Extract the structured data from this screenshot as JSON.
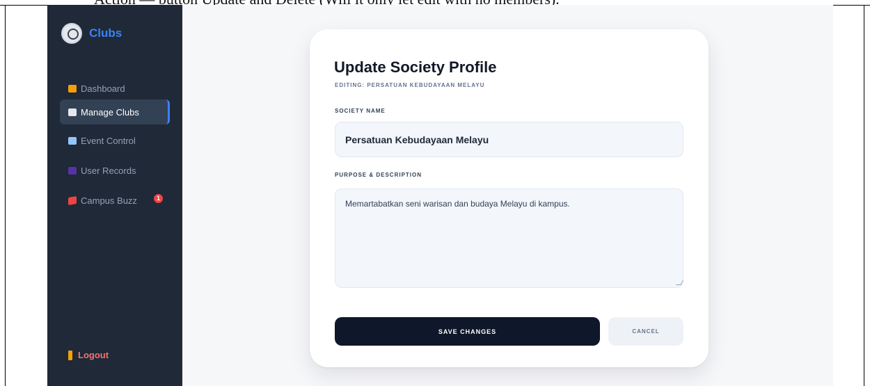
{
  "document": {
    "caption": "Action — button Update and Delete (Will it only let edit with no members)."
  },
  "app": {
    "name": "Clubs",
    "colors": {
      "brand": "#3b82f6",
      "sidebar": "#1f2937",
      "primary_button": "#0f172a",
      "badge": "#ef4444"
    }
  },
  "sidebar": {
    "items": [
      {
        "label": "Dashboard",
        "icon": "house-icon",
        "active": false
      },
      {
        "label": "Manage Clubs",
        "icon": "bank-icon",
        "active": true
      },
      {
        "label": "Event Control",
        "icon": "calendar-icon",
        "active": false
      },
      {
        "label": "User Records",
        "icon": "users-icon",
        "active": false
      },
      {
        "label": "Campus Buzz",
        "icon": "megaphone-icon",
        "active": false,
        "badge": "1"
      }
    ],
    "logout_label": "Logout"
  },
  "form": {
    "title": "Update Society Profile",
    "subtitle": "EDITING: PERSATUAN KEBUDAYAAN MELAYU",
    "name_label": "SOCIETY NAME",
    "name_value": "Persatuan Kebudayaan Melayu",
    "description_label": "PURPOSE & DESCRIPTION",
    "description_value": "Memartabatkan seni warisan dan budaya Melayu di kampus.",
    "save_label": "SAVE CHANGES",
    "cancel_label": "CANCEL"
  }
}
